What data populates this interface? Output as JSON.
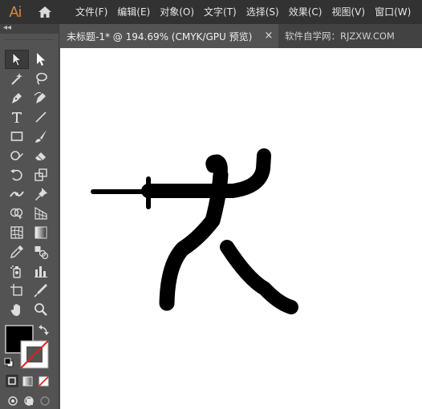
{
  "app": {
    "logo_text": "Ai",
    "menu": [
      {
        "label": "文件(F)"
      },
      {
        "label": "编辑(E)"
      },
      {
        "label": "对象(O)"
      },
      {
        "label": "文字(T)"
      },
      {
        "label": "选择(S)"
      },
      {
        "label": "效果(C)"
      },
      {
        "label": "视图(V)"
      },
      {
        "label": "窗口(W)"
      }
    ]
  },
  "document": {
    "tab_title": "未标题-1* @ 194.69% (CMYK/GPU 预览)",
    "close_glyph": "×",
    "watermark": "软件自学网：RJZXW.COM"
  },
  "toolbar": {
    "collapse_glyph": "◂◂",
    "tools": [
      [
        "selection-tool",
        "direct-selection-tool"
      ],
      [
        "magic-wand-tool",
        "lasso-tool"
      ],
      [
        "pen-tool",
        "curvature-tool"
      ],
      [
        "type-tool",
        "line-segment-tool"
      ],
      [
        "rectangle-tool",
        "paintbrush-tool"
      ],
      [
        "shaper-tool",
        "eraser-tool"
      ],
      [
        "rotate-tool",
        "scale-tool"
      ],
      [
        "width-tool",
        "puppet-warp-tool"
      ],
      [
        "shape-builder-tool",
        "perspective-grid-tool"
      ],
      [
        "mesh-tool",
        "gradient-tool"
      ],
      [
        "eyedropper-tool",
        "blend-tool"
      ],
      [
        "symbol-sprayer-tool",
        "column-graph-tool"
      ],
      [
        "artboard-tool",
        "slice-tool"
      ],
      [
        "hand-tool",
        "zoom-tool"
      ]
    ],
    "fill_color": "#000000",
    "stroke_color": "none"
  },
  "colors": {
    "accent": "#d98b3c",
    "canvas": "#ffffff",
    "artwork": "#000000"
  }
}
